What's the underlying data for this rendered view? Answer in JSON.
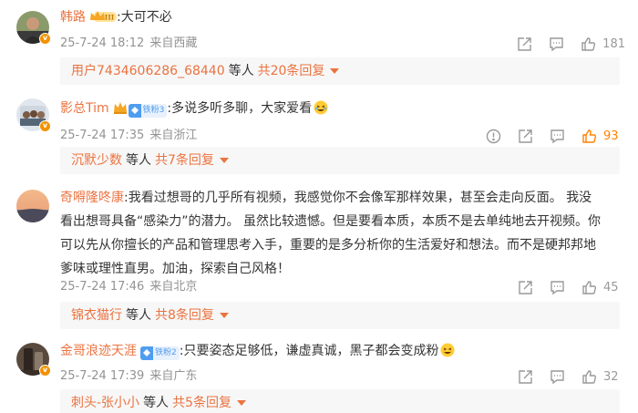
{
  "comments": [
    {
      "username": "韩路",
      "text": ":大可不必",
      "time": "25-7-24 18:12",
      "location": "来自西藏",
      "like_count": "181",
      "liked": false,
      "reply_user": "用户7434606286_68440",
      "reply_mid": "等人",
      "reply_count": "共20条回复",
      "badge": "crown",
      "badge_label": "III"
    },
    {
      "username": "影总Tim",
      "text": ":多说多听多聊，大家爱看",
      "time": "25-7-24 17:35",
      "location": "来自浙江",
      "like_count": "93",
      "liked": true,
      "reply_user": "沉默少数",
      "reply_mid": "等人",
      "reply_count": "共7条回复",
      "badge": "fan",
      "badge_label": "铁粉3"
    },
    {
      "username": "奇嘚隆咚康",
      "text_lines": [
        ":我看过想哥的几乎所有视频，我感觉你不会像军那样效果，甚至会走向反面。 我没",
        "看出想哥具备“感染力”的潜力。 虽然比较遗憾。但是要看本质，本质不是去单纯地去开视频。你",
        "可以先从你擅长的产品和管理思考入手，重要的是多分析你的生活爱好和想法。而不是硬邦邦地",
        "爹味或理性直男。加油，探索自己风格！"
      ],
      "time": "25-7-24 17:46",
      "location": "来自北京",
      "like_count": "45",
      "liked": false,
      "reply_user": "锦衣猫行",
      "reply_mid": "等人",
      "reply_count": "共8条回复"
    },
    {
      "username": "金哥浪迹天涯",
      "text": ":只要姿态足够低，谦虚真诚，黑子都会变成粉",
      "time": "25-7-24 17:39",
      "location": "来自广东",
      "like_count": "32",
      "liked": false,
      "reply_user": "刺头-张小小",
      "reply_mid": "等人",
      "reply_count": "共5条回复",
      "badge": "fan",
      "badge_label": "铁粉2"
    }
  ],
  "icons": {
    "report": "warning-icon",
    "share": "share-icon",
    "comment": "comment-icon",
    "like": "thumbs-up-icon",
    "verified": "verified-v-icon"
  },
  "colors": {
    "username": "#eb7340",
    "meta": "#939393",
    "liked": "#ff8200",
    "reply_bg": "#f7f7f7"
  }
}
